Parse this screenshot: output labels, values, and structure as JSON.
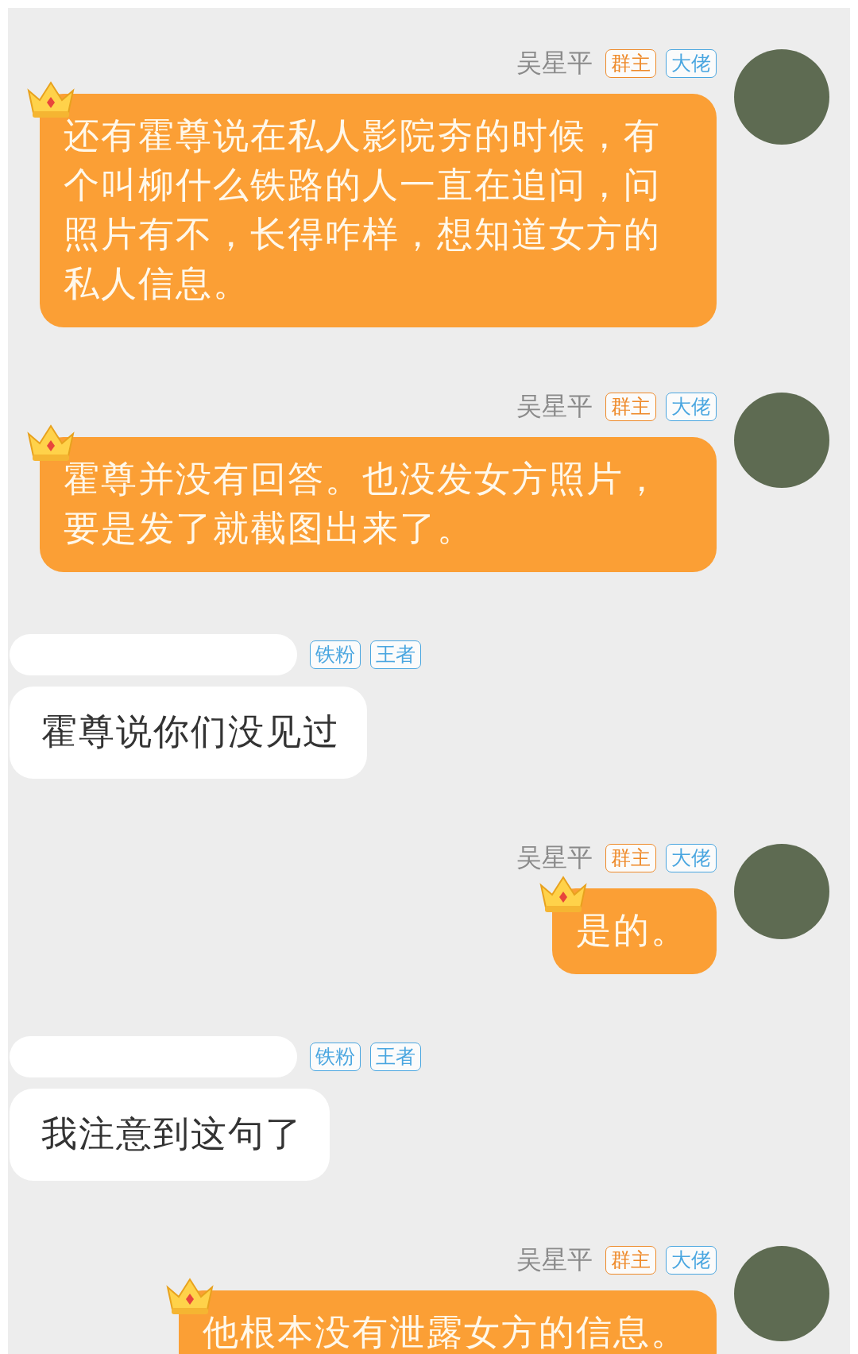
{
  "messages": [
    {
      "kind": "outgoing",
      "sender": "吴星平",
      "badges": [
        {
          "label": "群主",
          "color": "#ee8a2a"
        },
        {
          "label": "大佬",
          "color": "#4aa6e0"
        }
      ],
      "text": "还有霍尊说在私人影院夯的时候，有个叫柳什么铁路的人一直在追问，问照片有不，长得咋样，想知道女方的私人信息。"
    },
    {
      "kind": "outgoing",
      "sender": "吴星平",
      "badges": [
        {
          "label": "群主",
          "color": "#ee8a2a"
        },
        {
          "label": "大佬",
          "color": "#4aa6e0"
        }
      ],
      "text": "霍尊并没有回答。也没发女方照片，要是发了就截图出来了。"
    },
    {
      "kind": "incoming",
      "badges": [
        {
          "label": "铁粉",
          "color": "#4aa6e0"
        },
        {
          "label": "王者",
          "color": "#4aa6e0"
        }
      ],
      "text": "霍尊说你们没见过"
    },
    {
      "kind": "outgoing",
      "sender": "吴星平",
      "badges": [
        {
          "label": "群主",
          "color": "#ee8a2a"
        },
        {
          "label": "大佬",
          "color": "#4aa6e0"
        }
      ],
      "text": "是的。"
    },
    {
      "kind": "incoming",
      "badges": [
        {
          "label": "铁粉",
          "color": "#4aa6e0"
        },
        {
          "label": "王者",
          "color": "#4aa6e0"
        }
      ],
      "text": "我注意到这句了"
    },
    {
      "kind": "outgoing",
      "sender": "吴星平",
      "badges": [
        {
          "label": "群主",
          "color": "#ee8a2a"
        },
        {
          "label": "大佬",
          "color": "#4aa6e0"
        }
      ],
      "text": "他根本没有泄露女方的信息。"
    }
  ]
}
